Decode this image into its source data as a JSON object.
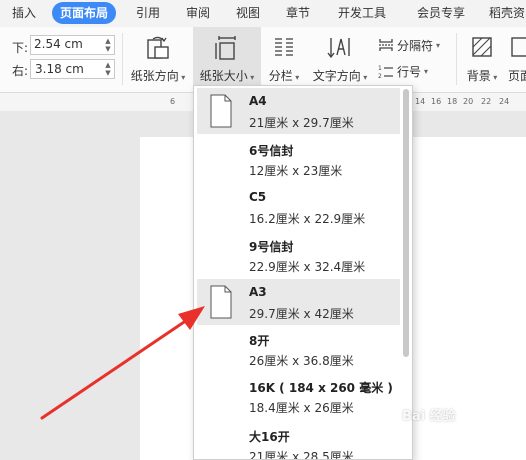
{
  "tabs": [
    {
      "label": "插入",
      "active": false
    },
    {
      "label": "页面布局",
      "active": true
    },
    {
      "label": "引用",
      "active": false
    },
    {
      "label": "审阅",
      "active": false
    },
    {
      "label": "视图",
      "active": false
    },
    {
      "label": "章节",
      "active": false
    },
    {
      "label": "开发工具",
      "active": false
    },
    {
      "label": "会员专享",
      "active": false
    },
    {
      "label": "稻壳资",
      "active": false
    }
  ],
  "margins": {
    "top_partial_value": "",
    "bottom_label": "下:",
    "bottom_value": "2.54 cm",
    "right_label": "右:",
    "right_value": "3.18 cm"
  },
  "ribbon": {
    "orientation": "纸张方向",
    "paper_size": "纸张大小",
    "columns": "分栏",
    "text_direction": "文字方向",
    "separator": "分隔符",
    "line_number": "行号",
    "background": "背景",
    "page_border": "页面"
  },
  "ruler": {
    "numbers": [
      "6",
      "14",
      "16",
      "18",
      "20",
      "22",
      "24"
    ]
  },
  "paper_sizes": [
    {
      "name": "A4",
      "size": "21厘米  x  29.7厘米",
      "selected": true
    },
    {
      "name": "6号信封",
      "size": "12厘米  x  23厘米",
      "selected": false
    },
    {
      "name": "C5",
      "size": "16.2厘米  x  22.9厘米",
      "selected": false
    },
    {
      "name": "9号信封",
      "size": "22.9厘米  x  32.4厘米",
      "selected": false
    },
    {
      "name": "A3",
      "size": "29.7厘米  x  42厘米",
      "selected": false,
      "hovered": true
    },
    {
      "name": "8开",
      "size": "26厘米  x  36.8厘米",
      "selected": false
    },
    {
      "name": "16K ( 184 x 260 毫米 )",
      "size": "18.4厘米  x  26厘米",
      "selected": false
    },
    {
      "name": "大16开",
      "size": "21厘米  x  28.5厘米",
      "selected": false
    }
  ],
  "watermark": "Bai 经验",
  "colors": {
    "accent": "#3d8af7",
    "arrow": "#e8312a"
  }
}
